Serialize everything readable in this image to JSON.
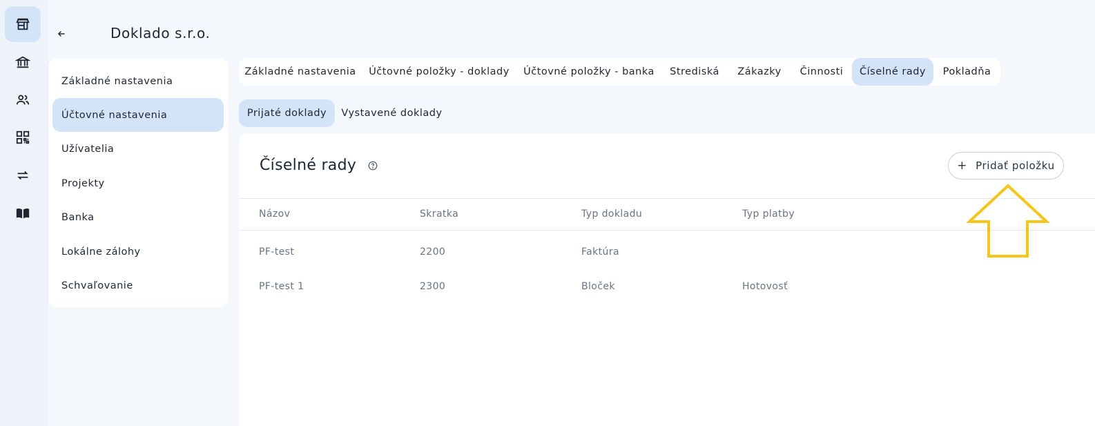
{
  "rail": {
    "items": [
      {
        "icon": "store-icon",
        "active": true
      },
      {
        "icon": "bank-icon",
        "active": false
      },
      {
        "icon": "users-icon",
        "active": false
      },
      {
        "icon": "qr-code-icon",
        "active": false
      },
      {
        "icon": "transfer-icon",
        "active": false
      },
      {
        "icon": "book-icon",
        "active": false
      }
    ]
  },
  "header": {
    "back_icon": "arrow-left-icon",
    "company_name": "Doklado s.r.o."
  },
  "side_menu": {
    "items": [
      {
        "label": "Základné nastavenia",
        "active": false
      },
      {
        "label": "Účtovné nastavenia",
        "active": true
      },
      {
        "label": "Užívatelia",
        "active": false
      },
      {
        "label": "Projekty",
        "active": false
      },
      {
        "label": "Banka",
        "active": false
      },
      {
        "label": "Lokálne zálohy",
        "active": false
      },
      {
        "label": "Schvaľovanie",
        "active": false
      }
    ]
  },
  "tabs": [
    {
      "label": "Základné nastavenia",
      "active": false
    },
    {
      "label": "Účtovné položky - doklady",
      "active": false
    },
    {
      "label": "Účtovné položky - banka",
      "active": false
    },
    {
      "label": "Strediská",
      "active": false
    },
    {
      "label": "Zákazky",
      "active": false
    },
    {
      "label": "Činnosti",
      "active": false
    },
    {
      "label": "Číselné rady",
      "active": true
    },
    {
      "label": "Pokladňa",
      "active": false
    }
  ],
  "subtabs": [
    {
      "label": "Prijaté doklady",
      "active": true
    },
    {
      "label": "Vystavené doklady",
      "active": false
    }
  ],
  "card": {
    "title": "Číselné rady",
    "help_icon": "help-circle-icon",
    "add_button_label": "Pridať položku",
    "add_icon": "plus-icon",
    "columns": [
      "Názov",
      "Skratka",
      "Typ dokladu",
      "Typ platby"
    ],
    "rows": [
      [
        "PF-test",
        "2200",
        "Faktúra",
        ""
      ],
      [
        "PF-test 1",
        "2300",
        "Bloček",
        "Hotovosť"
      ]
    ]
  },
  "colors": {
    "accent": "#d3e3f8",
    "annotation": "#f5c518"
  }
}
